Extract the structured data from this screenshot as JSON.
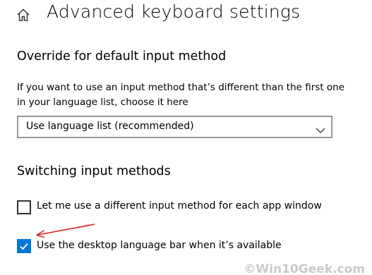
{
  "header": {
    "home_icon": "home-icon",
    "title": "Advanced keyboard settings"
  },
  "override_section": {
    "title": "Override for default input method",
    "description": "If you want to use an input method that’s different than the first one in your language list, choose it here",
    "dropdown": {
      "selected": "Use language list (recommended)",
      "icon": "chevron-down-icon"
    }
  },
  "switching_section": {
    "title": "Switching input methods",
    "options": [
      {
        "label": "Let me use a different input method for each app window",
        "checked": false
      },
      {
        "label": "Use the desktop language bar when it’s available",
        "checked": true
      }
    ]
  },
  "colors": {
    "accent": "#0078d7",
    "annotation_arrow": "#e0232a"
  },
  "watermark": "©Win10Geek.com"
}
